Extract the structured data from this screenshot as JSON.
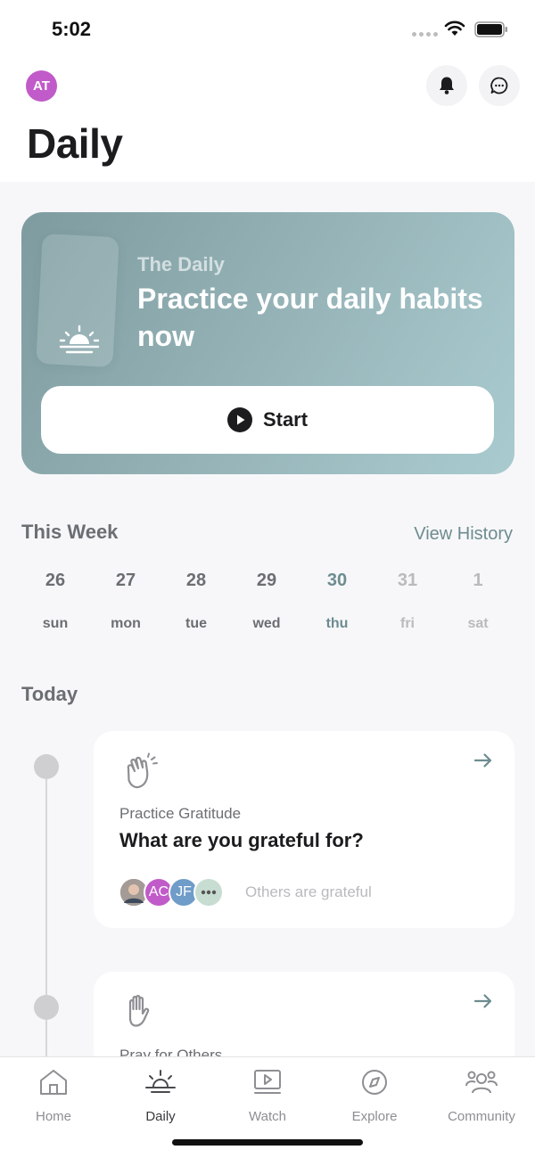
{
  "status_bar": {
    "time": "5:02"
  },
  "header": {
    "avatar_initials": "AT",
    "title": "Daily"
  },
  "hero": {
    "subtitle": "The Daily",
    "headline": "Practice your daily habits now",
    "start_label": "Start"
  },
  "week": {
    "title": "This Week",
    "view_history": "View History",
    "days": [
      {
        "num": "26",
        "name": "sun",
        "state": "past"
      },
      {
        "num": "27",
        "name": "mon",
        "state": "past"
      },
      {
        "num": "28",
        "name": "tue",
        "state": "past"
      },
      {
        "num": "29",
        "name": "wed",
        "state": "past"
      },
      {
        "num": "30",
        "name": "thu",
        "state": "today"
      },
      {
        "num": "31",
        "name": "fri",
        "state": "future"
      },
      {
        "num": "1",
        "name": "sat",
        "state": "future"
      }
    ]
  },
  "today": {
    "title": "Today",
    "tasks": [
      {
        "category": "Practice Gratitude",
        "question": "What are you grateful for?",
        "avatars": [
          "AC",
          "JF"
        ],
        "others_label": "Others are grateful"
      },
      {
        "category": "Pray for Others"
      }
    ]
  },
  "tab_bar": {
    "active": "Daily",
    "tabs": [
      "Home",
      "Daily",
      "Watch",
      "Explore",
      "Community"
    ]
  },
  "colors": {
    "accent": "#6d8c90",
    "avatar_purple": "#c15bc9",
    "avatar_blue": "#6f9cc8",
    "avatar_green": "#c7ddd1"
  }
}
